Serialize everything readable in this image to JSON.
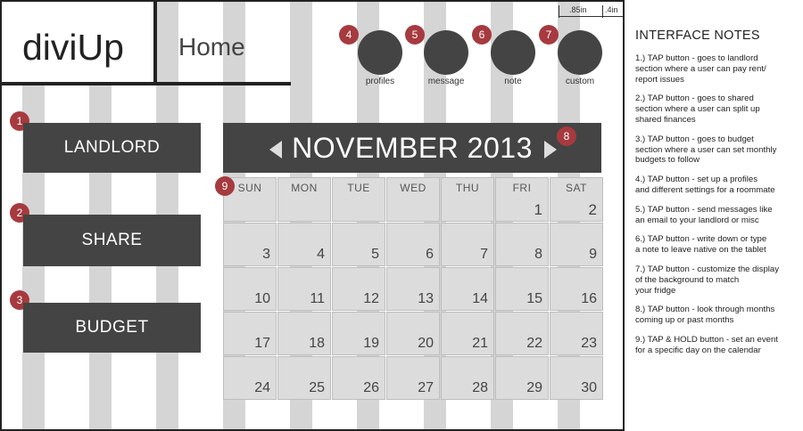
{
  "app": {
    "logo": "diviUp",
    "page_title": "Home"
  },
  "dimensions": {
    "col_width": ".85in",
    "gap_width": ".4in"
  },
  "top_buttons": [
    {
      "badge": "4",
      "label": "profiles"
    },
    {
      "badge": "5",
      "label": "message"
    },
    {
      "badge": "6",
      "label": "note"
    },
    {
      "badge": "7",
      "label": "custom"
    }
  ],
  "side_buttons": [
    {
      "badge": "1",
      "label": "LANDLORD"
    },
    {
      "badge": "2",
      "label": "SHARE"
    },
    {
      "badge": "3",
      "label": "BUDGET"
    }
  ],
  "calendar": {
    "month_title": "NOVEMBER 2013",
    "month_badge": "8",
    "grid_badge": "9",
    "weekdays": [
      "SUN",
      "MON",
      "TUE",
      "WED",
      "THU",
      "FRI",
      "SAT"
    ],
    "first_row": [
      "",
      "",
      "",
      "",
      "",
      "1",
      "2"
    ],
    "weeks": [
      [
        "3",
        "4",
        "5",
        "6",
        "7",
        "8",
        "9"
      ],
      [
        "10",
        "11",
        "12",
        "13",
        "14",
        "15",
        "16"
      ],
      [
        "17",
        "18",
        "19",
        "20",
        "21",
        "22",
        "23"
      ],
      [
        "24",
        "25",
        "26",
        "27",
        "28",
        "29",
        "30"
      ]
    ]
  },
  "notes": {
    "title": "INTERFACE NOTES",
    "items": [
      "1.) TAP button - goes to landlord\nsection where a user can pay rent/\nreport issues",
      "2.) TAP button - goes to shared\nsection where a user can split up\nshared finances",
      "3.) TAP button - goes to budget\nsection where a user can set monthly\nbudgets to follow",
      "4.) TAP button - set up a profiles\nand different settings for a roommate",
      "5.) TAP button - send messages like\nan email to your landlord or misc",
      "6.) TAP button - write down or type\na note to leave native on the tablet",
      "7.) TAP button - customize the display\nof the background to match\nyour fridge",
      "8.) TAP button - look through months\ncoming up or past months",
      "9.) TAP & HOLD button - set an event\nfor a specific day on the calendar"
    ]
  },
  "colors": {
    "button_dark": "#444444",
    "badge_red": "#a63a3f",
    "stripe_gray": "#d5d5d5",
    "cell_gray": "#dcdcdc"
  }
}
